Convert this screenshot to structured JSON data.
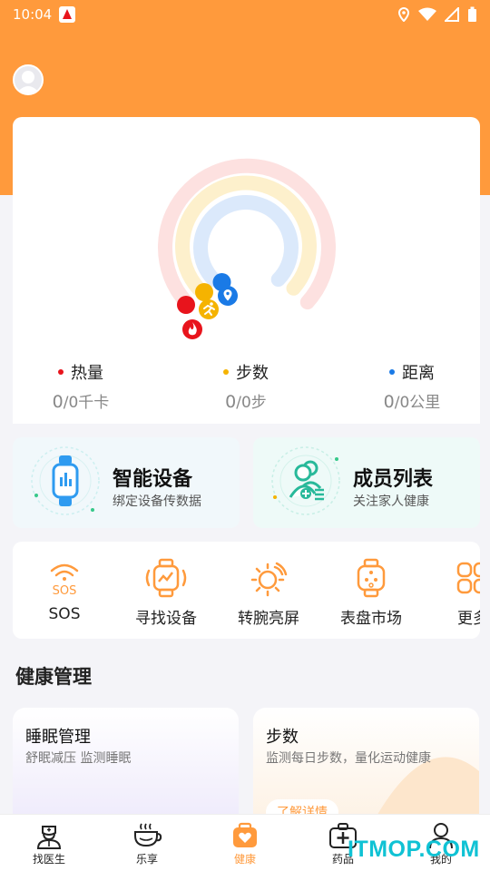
{
  "status_bar": {
    "time": "10:04"
  },
  "rings": {
    "metrics": [
      {
        "label": "热量",
        "value_current": "0",
        "value_rest": "/0千卡",
        "color": "#e8141c"
      },
      {
        "label": "步数",
        "value_current": "0",
        "value_rest": "/0步",
        "color": "#f5b300"
      },
      {
        "label": "距离",
        "value_current": "0",
        "value_rest": "/0公里",
        "color": "#1a7ae6"
      }
    ]
  },
  "feature_cards": [
    {
      "title": "智能设备",
      "subtitle": "绑定设备传数据"
    },
    {
      "title": "成员列表",
      "subtitle": "关注家人健康"
    }
  ],
  "quick_actions": [
    {
      "label": "SOS",
      "icon": "sos-icon"
    },
    {
      "label": "寻找设备",
      "icon": "find-device-icon"
    },
    {
      "label": "转腕亮屏",
      "icon": "wrist-wake-icon"
    },
    {
      "label": "表盘市场",
      "icon": "watch-face-icon"
    },
    {
      "label": "更多",
      "icon": "more-icon"
    }
  ],
  "health_section": {
    "title": "健康管理",
    "cards": [
      {
        "title": "睡眠管理",
        "subtitle": "舒眠减压 监测睡眠"
      },
      {
        "title": "步数",
        "subtitle": "监测每日步数，量化运动健康",
        "button": "了解详情"
      }
    ]
  },
  "bottom_nav": [
    {
      "label": "找医生",
      "icon": "doctor-icon",
      "active": false
    },
    {
      "label": "乐享",
      "icon": "coffee-cup-icon",
      "active": false
    },
    {
      "label": "健康",
      "icon": "health-kit-icon",
      "active": true
    },
    {
      "label": "药品",
      "icon": "medicine-box-icon",
      "active": false
    },
    {
      "label": "我的",
      "icon": "profile-icon",
      "active": false
    }
  ],
  "watermark": "ITMOP.COM",
  "colors": {
    "accent": "#ff9a3c",
    "calorie": "#e8141c",
    "steps": "#f5b300",
    "distance": "#1a7ae6"
  }
}
